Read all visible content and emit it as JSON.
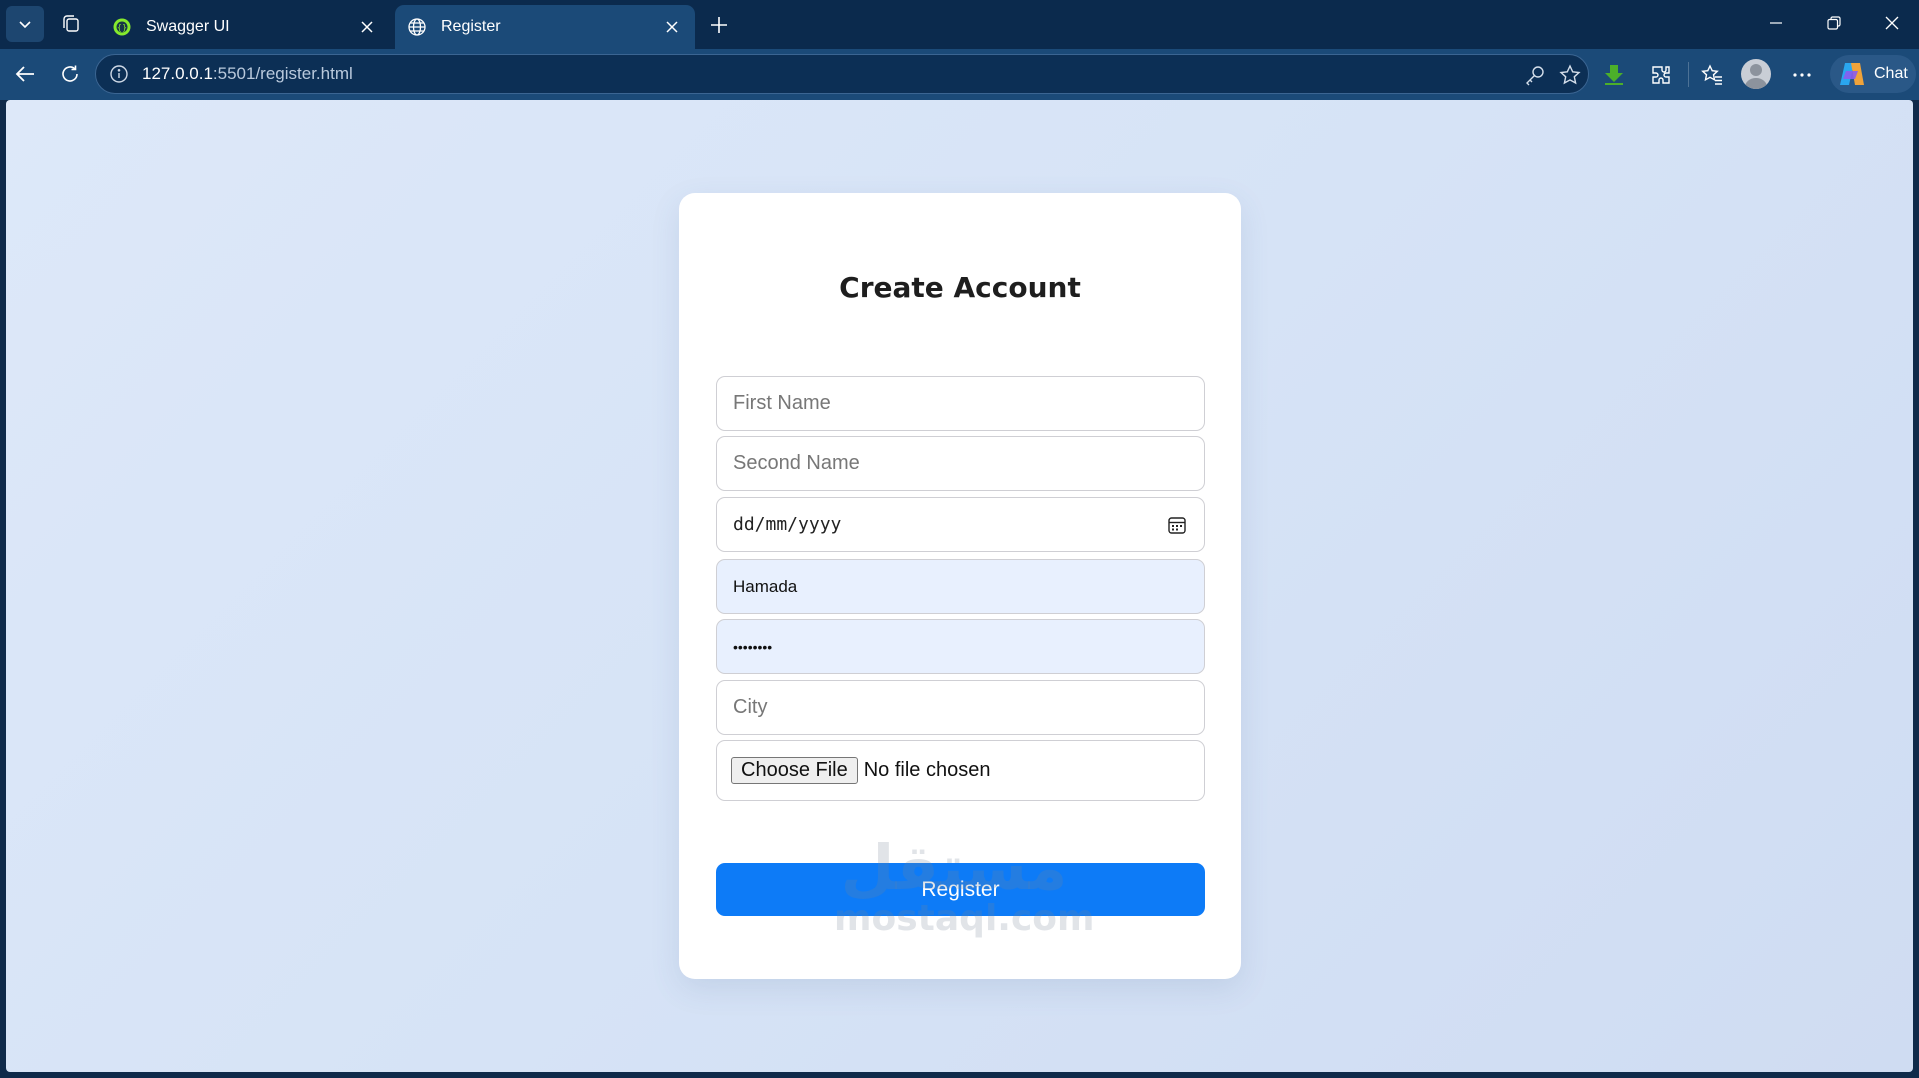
{
  "browser": {
    "tabs": [
      {
        "title": "Swagger UI",
        "icon": "swagger-icon",
        "active": false
      },
      {
        "title": "Register",
        "icon": "globe-icon",
        "active": true
      }
    ],
    "url_host": "127.0.0.1",
    "url_rest": ":5501/register.html",
    "chat_label": "Chat"
  },
  "form": {
    "title": "Create Account",
    "first_name_placeholder": "First Name",
    "second_name_placeholder": "Second Name",
    "date_placeholder": "dd/mm/yyyy",
    "username_value": "Hamada",
    "password_value": "••••••••",
    "city_placeholder": "City",
    "choose_file_label": "Choose File",
    "file_status": "No file chosen",
    "register_label": "Register"
  },
  "watermark": {
    "arabic": "مستقل",
    "latin": "mostaql.com"
  },
  "colors": {
    "primary_button": "#0d7bf7",
    "autofill_bg": "#e8f0fe",
    "chrome_dark": "#0b2a4d"
  }
}
